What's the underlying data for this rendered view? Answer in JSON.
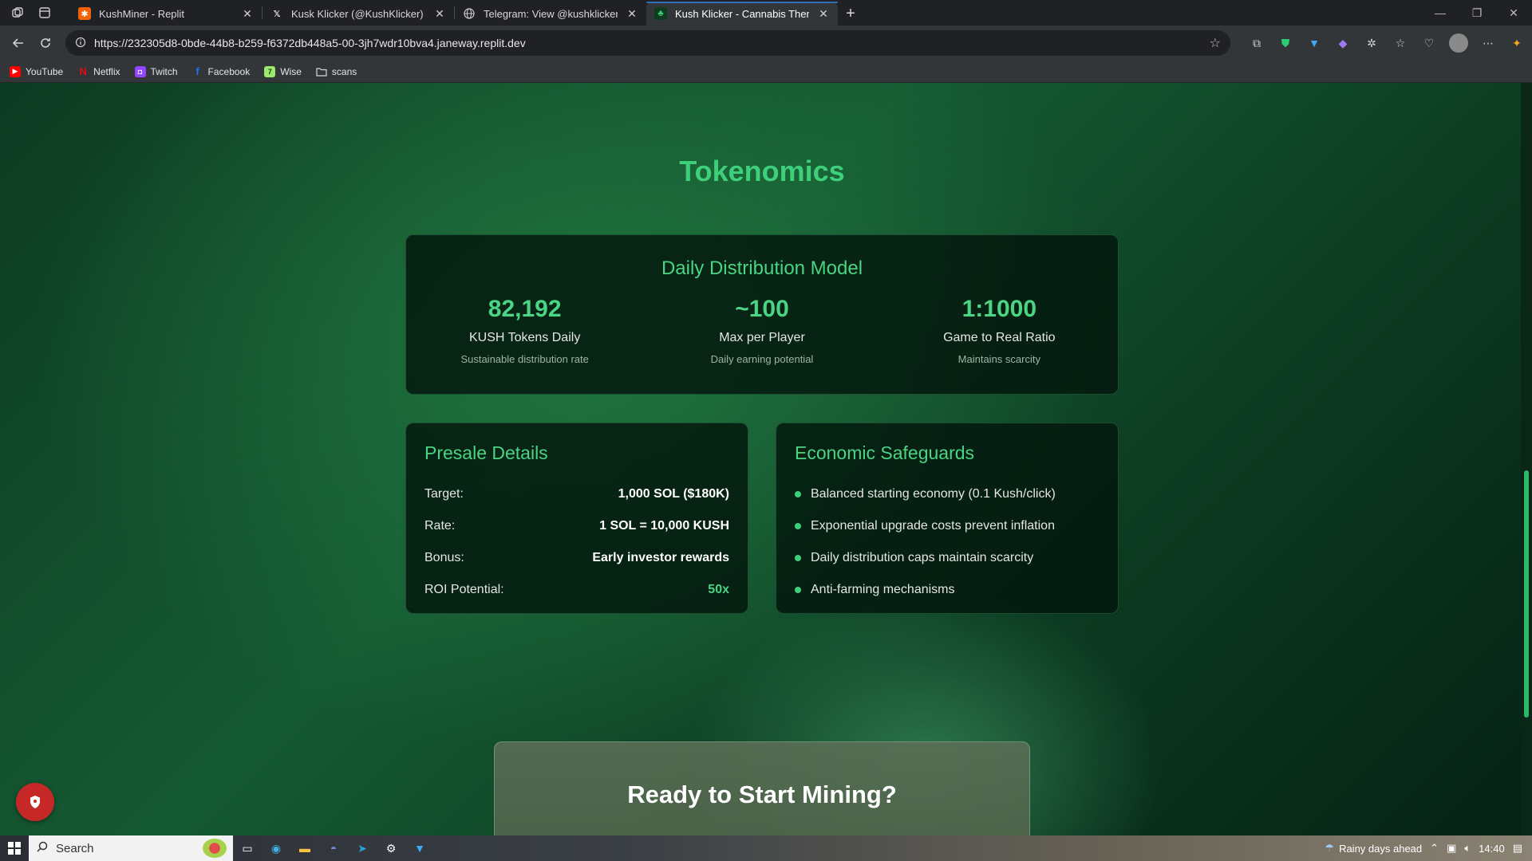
{
  "browser": {
    "tabs": [
      {
        "title": "KushMiner - Replit",
        "favicon": "replit-icon",
        "active": false
      },
      {
        "title": "Kusk Klicker (@KushKlicker) / X",
        "favicon": "x-icon",
        "active": false
      },
      {
        "title": "Telegram: View @kushklicker",
        "favicon": "globe-icon",
        "active": false
      },
      {
        "title": "Kush Klicker - Cannabis Themed C",
        "favicon": "leaf-icon",
        "active": true
      }
    ],
    "new_tab_label": "+",
    "url": "https://232305d8-0bde-44b8-b259-f6372db448a5-00-3jh7wdr10bva4.janeway.replit.dev",
    "bookmarks": [
      {
        "label": "YouTube",
        "icon": "youtube-icon"
      },
      {
        "label": "Netflix",
        "icon": "netflix-icon"
      },
      {
        "label": "Twitch",
        "icon": "twitch-icon"
      },
      {
        "label": "Facebook",
        "icon": "facebook-icon"
      },
      {
        "label": "Wise",
        "icon": "wise-icon"
      },
      {
        "label": "scans",
        "icon": "folder-icon"
      }
    ]
  },
  "page": {
    "section_title": "Tokenomics",
    "distribution": {
      "title": "Daily Distribution Model",
      "stats": [
        {
          "value": "82,192",
          "label": "KUSH Tokens Daily",
          "sub": "Sustainable distribution rate"
        },
        {
          "value": "~100",
          "label": "Max per Player",
          "sub": "Daily earning potential"
        },
        {
          "value": "1:1000",
          "label": "Game to Real Ratio",
          "sub": "Maintains scarcity"
        }
      ]
    },
    "presale": {
      "title": "Presale Details",
      "rows": [
        {
          "key": "Target:",
          "value": "1,000 SOL ($180K)"
        },
        {
          "key": "Rate:",
          "value": "1 SOL = 10,000 KUSH"
        },
        {
          "key": "Bonus:",
          "value": "Early investor rewards"
        },
        {
          "key": "ROI Potential:",
          "value": "50x"
        }
      ]
    },
    "safeguards": {
      "title": "Economic Safeguards",
      "items": [
        "Balanced starting economy (0.1 Kush/click)",
        "Exponential upgrade costs prevent inflation",
        "Daily distribution caps maintain scarcity",
        "Anti-farming mechanisms"
      ]
    },
    "cta": {
      "title": "Ready to Start Mining?"
    }
  },
  "taskbar": {
    "search_placeholder": "Search",
    "weather": "Rainy days ahead",
    "time": "14:40"
  },
  "colors": {
    "accent_green": "#4ad483",
    "danger_red": "#c62828"
  }
}
